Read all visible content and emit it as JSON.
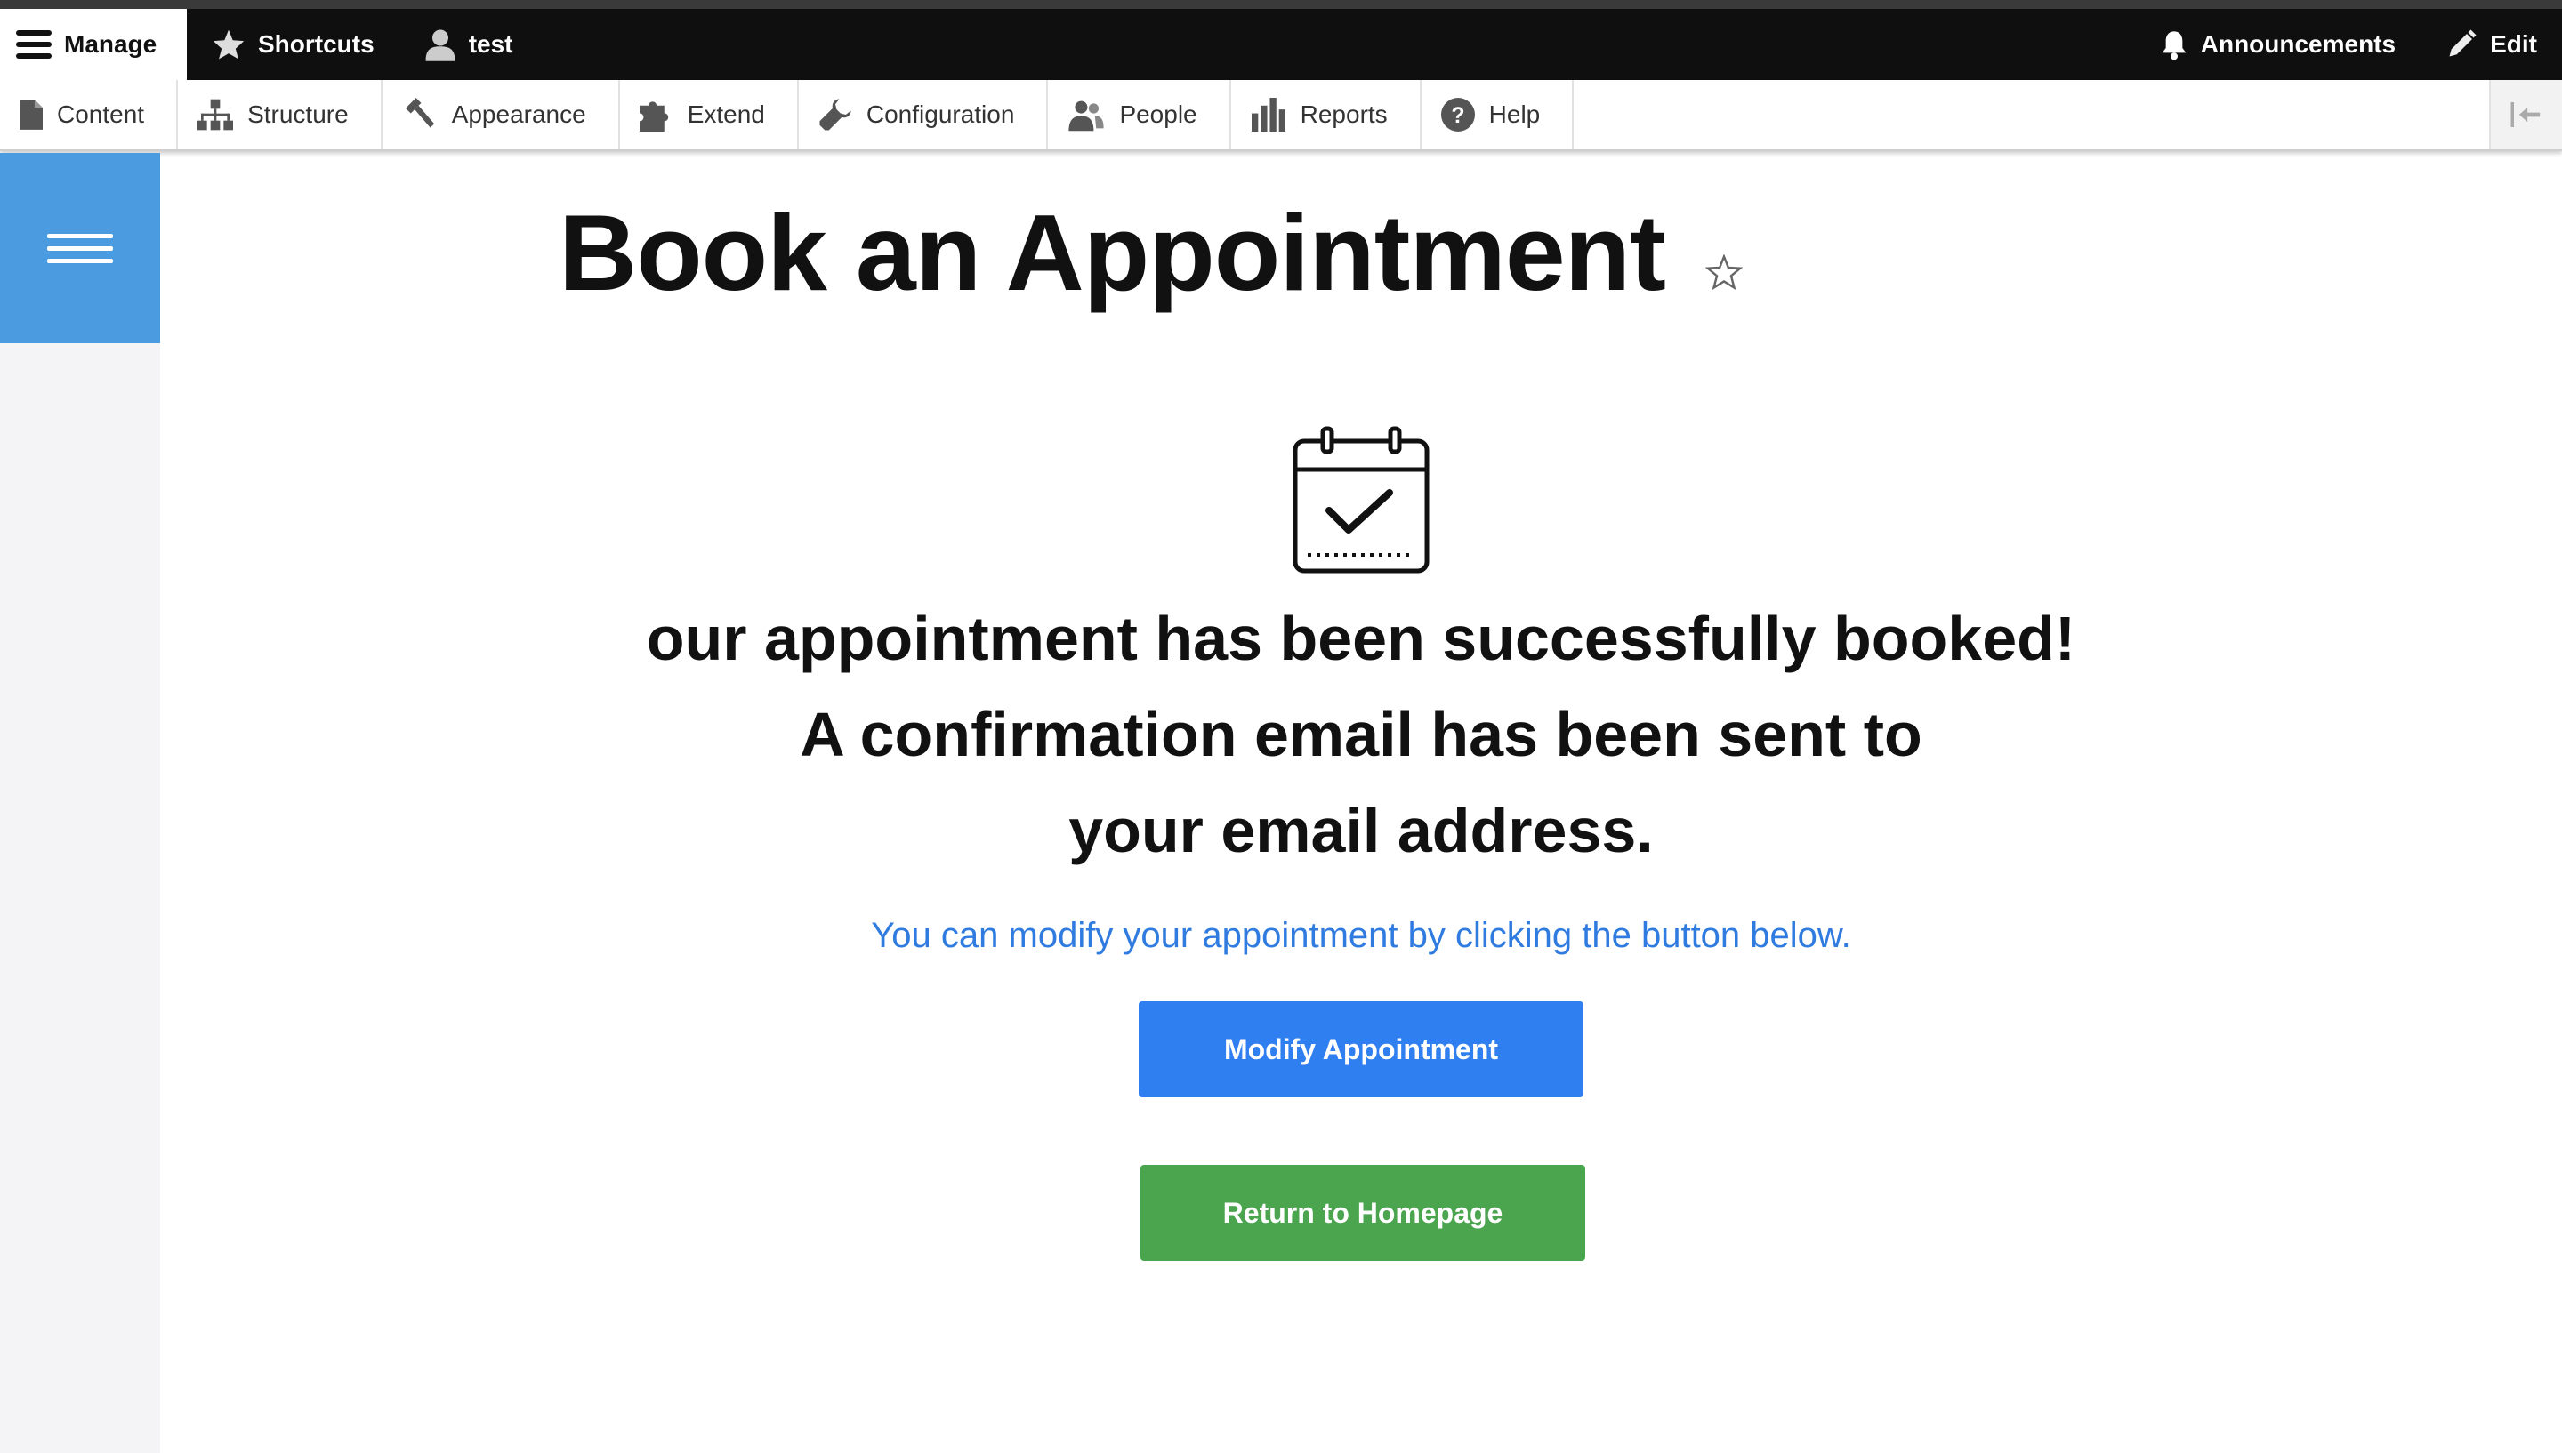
{
  "toolbar": {
    "manage_label": "Manage",
    "shortcuts_label": "Shortcuts",
    "user_label": "test",
    "announcements_label": "Announcements",
    "edit_label": "Edit"
  },
  "tray": {
    "items": [
      {
        "label": "Content",
        "icon": "file-icon"
      },
      {
        "label": "Structure",
        "icon": "sitemap-icon"
      },
      {
        "label": "Appearance",
        "icon": "paintbrush-icon"
      },
      {
        "label": "Extend",
        "icon": "puzzle-icon"
      },
      {
        "label": "Configuration",
        "icon": "wrench-icon"
      },
      {
        "label": "People",
        "icon": "people-icon"
      },
      {
        "label": "Reports",
        "icon": "bar-chart-icon"
      },
      {
        "label": "Help",
        "icon": "question-icon"
      }
    ]
  },
  "page": {
    "title": "Book an Appointment",
    "confirmation_line1": "our appointment has been successfully booked!",
    "confirmation_line2": "A confirmation email has been sent to",
    "confirmation_line3": "your email address.",
    "modify_hint": "You can modify your appointment by clicking the button below.",
    "modify_button": "Modify Appointment",
    "home_button": "Return to Homepage"
  },
  "colors": {
    "toolbar_bg": "#0f0f0f",
    "sidebar_toggle": "#4a9be0",
    "link_blue": "#2f7be0",
    "modify_button": "#2f7ff0",
    "home_button": "#4aa54e"
  }
}
